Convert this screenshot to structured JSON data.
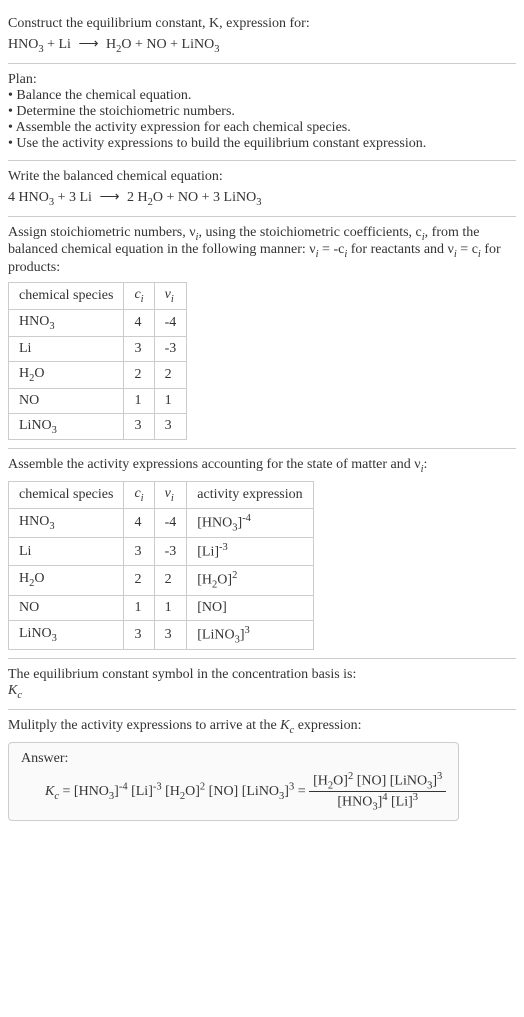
{
  "intro": {
    "line1": "Construct the equilibrium constant, K, expression for:",
    "eq_lhs1": "HNO",
    "eq_lhs1_sub": "3",
    "eq_plus1": " + Li ",
    "eq_arrow": "⟶",
    "eq_rhs": " H",
    "eq_rhs_sub1": "2",
    "eq_rhs2": "O + NO + LiNO",
    "eq_rhs_sub2": "3"
  },
  "plan": {
    "title": "Plan:",
    "b1": "• Balance the chemical equation.",
    "b2": "• Determine the stoichiometric numbers.",
    "b3": "• Assemble the activity expression for each chemical species.",
    "b4": "• Use the activity expressions to build the equilibrium constant expression."
  },
  "balanced": {
    "title": "Write the balanced chemical equation:",
    "c1": "4 HNO",
    "s1": "3",
    "p1": " + 3 Li ",
    "arrow": "⟶",
    "p2": " 2 H",
    "s2": "2",
    "p3": "O + NO + 3 LiNO",
    "s3": "3"
  },
  "assign": {
    "line": "Assign stoichiometric numbers, ν",
    "sub_i": "i",
    "line2": ", using the stoichiometric coefficients, c",
    "line3": ", from the balanced chemical equation in the following manner: ν",
    "eq1": " = -c",
    "line4": " for reactants and ν",
    "eq2": " = c",
    "line5": " for products:"
  },
  "table1": {
    "h1": "chemical species",
    "h2": "c",
    "h2sub": "i",
    "h3": "ν",
    "h3sub": "i",
    "rows": [
      {
        "sp": "HNO",
        "spsub": "3",
        "c": "4",
        "v": "-4"
      },
      {
        "sp": "Li",
        "spsub": "",
        "c": "3",
        "v": "-3"
      },
      {
        "sp": "H",
        "spsub": "2",
        "sp2": "O",
        "c": "2",
        "v": "2"
      },
      {
        "sp": "NO",
        "spsub": "",
        "c": "1",
        "v": "1"
      },
      {
        "sp": "LiNO",
        "spsub": "3",
        "c": "3",
        "v": "3"
      }
    ]
  },
  "assemble": {
    "line": "Assemble the activity expressions accounting for the state of matter and ν",
    "sub": "i",
    "colon": ":"
  },
  "table2": {
    "h1": "chemical species",
    "h2": "c",
    "h2sub": "i",
    "h3": "ν",
    "h3sub": "i",
    "h4": "activity expression",
    "rows": [
      {
        "sp": "HNO",
        "spsub": "3",
        "c": "4",
        "v": "-4",
        "ae_base": "[HNO",
        "ae_sub": "3",
        "ae_close": "]",
        "ae_exp": "-4"
      },
      {
        "sp": "Li",
        "spsub": "",
        "c": "3",
        "v": "-3",
        "ae_base": "[Li]",
        "ae_sub": "",
        "ae_close": "",
        "ae_exp": "-3"
      },
      {
        "sp": "H",
        "spsub": "2",
        "sp2": "O",
        "c": "2",
        "v": "2",
        "ae_base": "[H",
        "ae_sub": "2",
        "ae_close": "O]",
        "ae_exp": "2"
      },
      {
        "sp": "NO",
        "spsub": "",
        "c": "1",
        "v": "1",
        "ae_base": "[NO]",
        "ae_sub": "",
        "ae_close": "",
        "ae_exp": ""
      },
      {
        "sp": "LiNO",
        "spsub": "3",
        "c": "3",
        "v": "3",
        "ae_base": "[LiNO",
        "ae_sub": "3",
        "ae_close": "]",
        "ae_exp": "3"
      }
    ]
  },
  "kc_symbol": {
    "line": "The equilibrium constant symbol in the concentration basis is:",
    "sym": "K",
    "sub": "c"
  },
  "multiply": {
    "line1": "Mulitply the activity expressions to arrive at the ",
    "k": "K",
    "ksub": "c",
    "line2": " expression:"
  },
  "answer": {
    "label": "Answer:",
    "lhs_k": "K",
    "lhs_sub": "c",
    "eq": " = ",
    "t1": "[HNO",
    "t1s": "3",
    "t1c": "]",
    "t1e": "-4",
    "t2": " [Li]",
    "t2e": "-3",
    "t3": " [H",
    "t3s": "2",
    "t3c": "O]",
    "t3e": "2",
    "t4": " [NO] [LiNO",
    "t4s": "3",
    "t4c": "]",
    "t4e": "3",
    "eq2": " = ",
    "num1": "[H",
    "num1s": "2",
    "num1c": "O]",
    "num1e": "2",
    "num2": " [NO] [LiNO",
    "num2s": "3",
    "num2c": "]",
    "num2e": "3",
    "den1": "[HNO",
    "den1s": "3",
    "den1c": "]",
    "den1e": "4",
    "den2": " [Li]",
    "den2e": "3"
  }
}
